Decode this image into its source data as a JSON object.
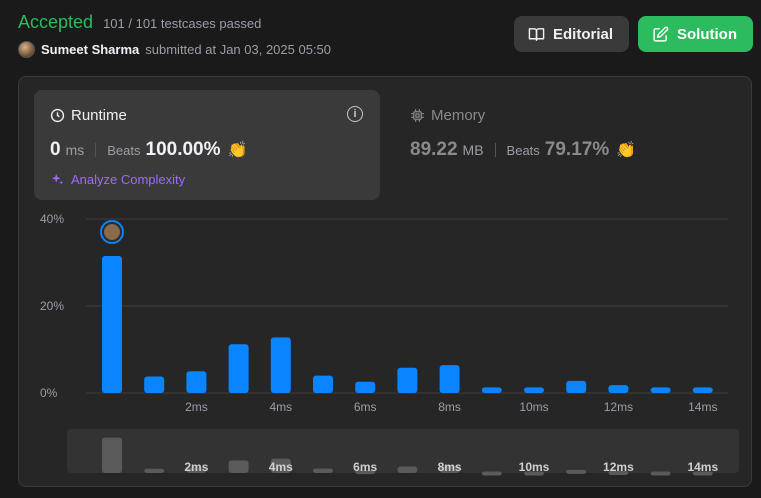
{
  "header": {
    "status": "Accepted",
    "testcases": "101 / 101 testcases passed",
    "author": "Sumeet Sharma",
    "submitted": "submitted at Jan 03, 2025 05:50",
    "editorial_label": "Editorial",
    "solution_label": "Solution"
  },
  "runtime": {
    "title": "Runtime",
    "info": "i",
    "value": "0",
    "unit": "ms",
    "beats_label": "Beats",
    "beats": "100.00%",
    "analyze_label": "Analyze Complexity"
  },
  "memory": {
    "title": "Memory",
    "value": "89.22",
    "unit": "MB",
    "beats_label": "Beats",
    "beats": "79.17%"
  },
  "colors": {
    "accepted": "#2cbb5d",
    "bar": "#0a84ff",
    "overview_bar": "#5a5a5a",
    "accent_purple": "#9b6bff"
  },
  "chart_data": {
    "type": "bar",
    "ylim": [
      0,
      40
    ],
    "y_ticks": [
      "0%",
      "20%",
      "40%"
    ],
    "y_tick_values": [
      0,
      20,
      40
    ],
    "x_tick_labels": [
      "2ms",
      "4ms",
      "6ms",
      "8ms",
      "10ms",
      "12ms",
      "14ms"
    ],
    "x_tick_values": [
      2,
      4,
      6,
      8,
      10,
      12,
      14
    ],
    "x": [
      0,
      1,
      2,
      3,
      4,
      5,
      6,
      7,
      8,
      9,
      10,
      11,
      12,
      13,
      14
    ],
    "values": [
      31.5,
      3.8,
      5.0,
      11.2,
      12.8,
      4.0,
      2.6,
      5.8,
      6.4,
      1.3,
      1.3,
      2.8,
      1.8,
      1.3,
      1.3
    ],
    "highlight_index": 0,
    "grid": true
  }
}
